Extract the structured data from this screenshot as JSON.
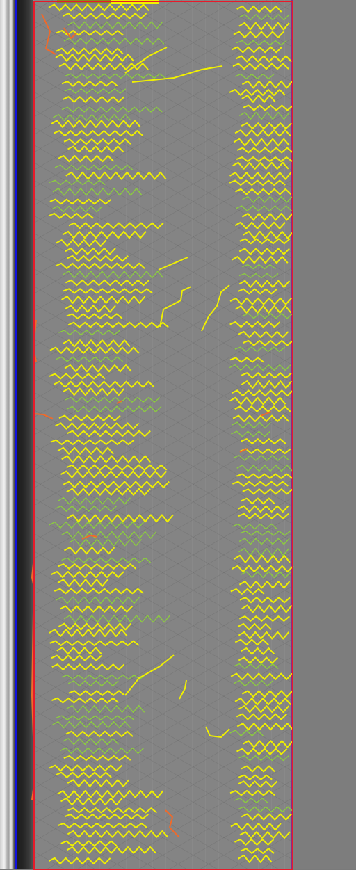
{
  "image": {
    "description_free": true,
    "colors": {
      "background_gray": "#848484",
      "side_pane_gray": "#7d7d7d",
      "roi_border": "#e81a2a",
      "vertical_marker": "#1111dd",
      "crack_yellow": "#f0f000",
      "crack_green": "#8ccf3c",
      "crack_orange": "#f06a2a"
    }
  }
}
